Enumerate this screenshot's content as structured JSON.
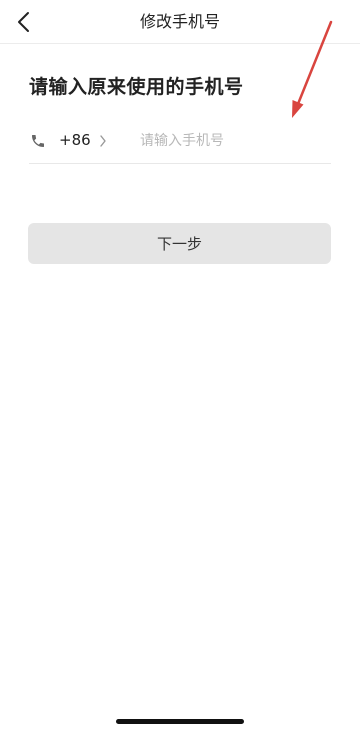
{
  "navbar": {
    "title": "修改手机号",
    "back_icon": "chevron-left-icon"
  },
  "main": {
    "heading": "请输入原来使用的手机号",
    "phone_row": {
      "icon": "phone-icon",
      "country_code": "+86",
      "chevron_icon": "chevron-right-icon",
      "input_value": "",
      "input_placeholder": "请输入手机号"
    },
    "next_button_label": "下一步"
  },
  "annotation": {
    "arrow_color": "#d9453f"
  },
  "colors": {
    "button_bg": "#e5e5e5",
    "placeholder": "#b8b8b8",
    "text": "#222222"
  }
}
